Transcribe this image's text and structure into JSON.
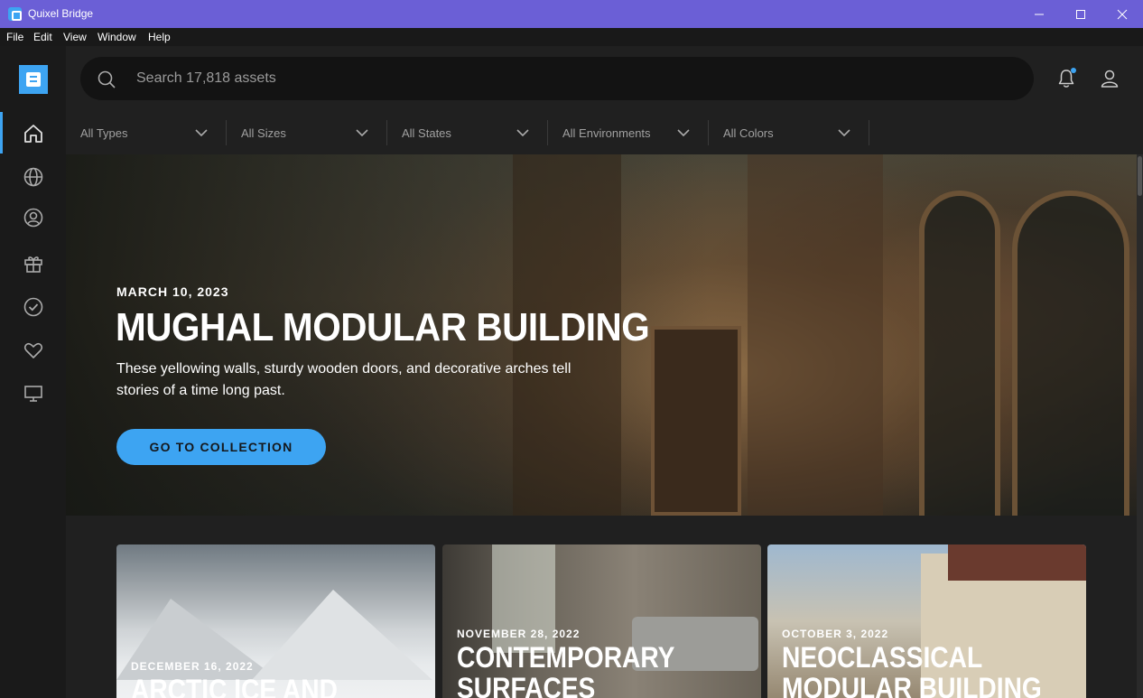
{
  "window": {
    "title": "Quixel Bridge"
  },
  "menu": [
    "File",
    "Edit",
    "View",
    "Window",
    "Help"
  ],
  "nav": {
    "items": [
      "home-icon",
      "globe-icon",
      "user-circle-icon",
      "gift-icon",
      "check-circle-icon",
      "heart-icon",
      "monitor-icon"
    ],
    "active_index": 0
  },
  "search": {
    "placeholder": "Search 17,818 assets"
  },
  "filters": [
    "All Types",
    "All Sizes",
    "All States",
    "All Environments",
    "All Colors"
  ],
  "hero": {
    "date": "MARCH 10, 2023",
    "title": "MUGHAL MODULAR BUILDING",
    "description": "These yellowing walls, sturdy wooden doors, and decorative arches tell stories of a time long past.",
    "cta_label": "GO TO COLLECTION"
  },
  "cards": [
    {
      "date": "DECEMBER 16, 2022",
      "title": "ARCTIC ICE AND"
    },
    {
      "date": "NOVEMBER 28, 2022",
      "title": "CONTEMPORARY SURFACES"
    },
    {
      "date": "OCTOBER 3, 2022",
      "title": "NEOCLASSICAL MODULAR BUILDING"
    }
  ],
  "colors": {
    "accent": "#3da4f2",
    "titlebar": "#6b5fd6"
  }
}
